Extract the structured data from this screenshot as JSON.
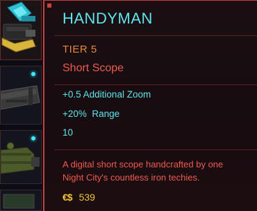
{
  "item": {
    "name": "HANDYMAN",
    "tier": "TIER 5",
    "type": "Short Scope",
    "stats": [
      "+0.5 Additional Zoom",
      "+20%  Range",
      "10"
    ],
    "description_lines": [
      "A digital short scope handcrafted by one",
      "Night City's countless iron techies."
    ],
    "price_icon": "€$",
    "price": "539"
  },
  "inventory": {
    "slots": [
      {
        "icon": "handyman-scope-icon"
      },
      {
        "icon": "weapon-attachment-icon"
      },
      {
        "icon": "weapon-attachment-icon"
      },
      {
        "icon": "weapon-attachment-icon"
      }
    ]
  },
  "colors": {
    "accent_cyan": "#5fe6ec",
    "accent_red": "#ef5a4f",
    "tier_orange": "#e9883a",
    "currency_gold": "#f2c23a",
    "border_red": "#c9403f"
  }
}
